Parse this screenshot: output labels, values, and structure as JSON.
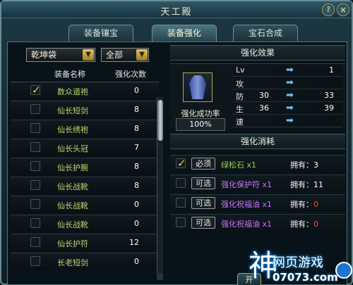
{
  "window": {
    "title": "天工殿",
    "help_label": "?",
    "close_label": "×"
  },
  "tabs": [
    {
      "label": "装备镶宝",
      "active": false
    },
    {
      "label": "装备强化",
      "active": true
    },
    {
      "label": "宝石合成",
      "active": false
    }
  ],
  "left": {
    "bag_select": "乾坤袋",
    "filter_select": "全部",
    "headers": {
      "name": "装备名称",
      "count": "强化次数"
    },
    "items": [
      {
        "name": "数众道袍",
        "count": "0",
        "checked": true
      },
      {
        "name": "仙长短剑",
        "count": "8",
        "checked": false
      },
      {
        "name": "仙长绣袍",
        "count": "8",
        "checked": false
      },
      {
        "name": "仙长头冠",
        "count": "7",
        "checked": false
      },
      {
        "name": "仙长护腕",
        "count": "8",
        "checked": false
      },
      {
        "name": "仙长战靴",
        "count": "8",
        "checked": false
      },
      {
        "name": "仙长战靴",
        "count": "0",
        "checked": false
      },
      {
        "name": "仙长战靴",
        "count": "0",
        "checked": false
      },
      {
        "name": "仙长护符",
        "count": "12",
        "checked": false
      },
      {
        "name": "长老短剑",
        "count": "0",
        "checked": false
      }
    ]
  },
  "effect": {
    "title": "强化效果",
    "success_label": "强化成功率",
    "success_value": "100%",
    "stats": [
      {
        "label": "Lv",
        "from": "",
        "to": "1"
      },
      {
        "label": "攻",
        "from": "",
        "to": ""
      },
      {
        "label": "防",
        "from": "30",
        "to": "33"
      },
      {
        "label": "生",
        "from": "36",
        "to": "39"
      },
      {
        "label": "速",
        "from": "",
        "to": ""
      }
    ]
  },
  "cost": {
    "title": "强化消耗",
    "owned_prefix": "拥有：",
    "rows": [
      {
        "checked": true,
        "tag": "必须",
        "material": "绿松石 x1",
        "owned": "3",
        "color": "green"
      },
      {
        "checked": false,
        "tag": "可选",
        "material": "强化保护符 x1",
        "owned": "11",
        "color": "purple"
      },
      {
        "checked": false,
        "tag": "可选",
        "material": "强化祝福油 x1",
        "owned": "0",
        "color": "purple"
      },
      {
        "checked": false,
        "tag": "可选",
        "material": "强化祝福油 x1",
        "owned": "0",
        "color": "purple"
      }
    ]
  },
  "bottom_button": "开",
  "watermark": {
    "main": "神",
    "site": "网页游戏",
    "domain": "07073.com"
  },
  "icons": {
    "item_slot": "blue-robe-icon",
    "arrow": "right-arrow-icon",
    "checkbox": "check-icon"
  }
}
